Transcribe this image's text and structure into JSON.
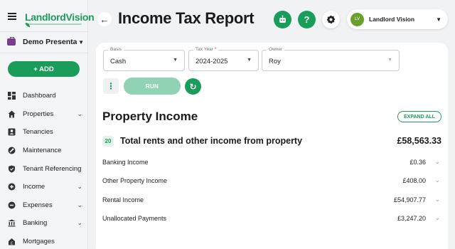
{
  "sidebar": {
    "logo": "LandlordVision",
    "organization": "Demo Presentati...",
    "add_label": "+ ADD",
    "items": [
      {
        "label": "Dashboard",
        "icon": "dashboard-icon",
        "expandable": false
      },
      {
        "label": "Properties",
        "icon": "home-icon",
        "expandable": true
      },
      {
        "label": "Tenancies",
        "icon": "tenancies-icon",
        "expandable": false
      },
      {
        "label": "Maintenance",
        "icon": "wrench-icon",
        "expandable": false
      },
      {
        "label": "Tenant Referencing",
        "icon": "shield-icon",
        "expandable": false
      },
      {
        "label": "Income",
        "icon": "plus-circle-icon",
        "expandable": true
      },
      {
        "label": "Expenses",
        "icon": "minus-circle-icon",
        "expandable": true
      },
      {
        "label": "Banking",
        "icon": "bank-icon",
        "expandable": true
      },
      {
        "label": "Mortgages",
        "icon": "mortgage-icon",
        "expandable": false
      }
    ]
  },
  "header": {
    "title": "Income Tax Report",
    "user_initials": "LV",
    "user_name": "Landlord Vision"
  },
  "filters": {
    "basis": {
      "label": "Basis",
      "value": "Cash"
    },
    "tax_year": {
      "label": "Tax Year",
      "required_mark": "*",
      "value": "2024-2025"
    },
    "owner": {
      "label": "Owner",
      "value": "Roy"
    }
  },
  "actions": {
    "run_label": "RUN",
    "more_icon": "more-vert-icon",
    "refresh_icon": "refresh-icon"
  },
  "report": {
    "section_title": "Property Income",
    "expand_all_label": "EXPAND ALL",
    "total": {
      "code": "20",
      "label": "Total rents and other income from property",
      "value": "£58,563.33"
    },
    "rows": [
      {
        "label": "Banking Income",
        "value": "£0.36"
      },
      {
        "label": "Other Property Income",
        "value": "£408.00"
      },
      {
        "label": "Rental Income",
        "value": "£54,907.77"
      },
      {
        "label": "Unallocated Payments",
        "value": "£3,247.20"
      }
    ]
  },
  "colors": {
    "brand_green": "#1a9c5a",
    "run_disabled": "#8fd3b4",
    "avatar_green": "#6aa12c",
    "org_purple": "#7a3d8c"
  }
}
